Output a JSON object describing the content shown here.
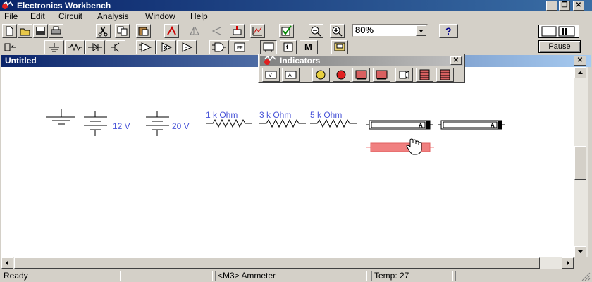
{
  "app": {
    "title": "Electronics Workbench"
  },
  "window_controls": {
    "minimize": "_",
    "restore": "❐",
    "close": "✕"
  },
  "menu": {
    "items": [
      {
        "label": "File"
      },
      {
        "label": "Edit"
      },
      {
        "label": "Circuit"
      },
      {
        "label": "Analysis"
      },
      {
        "label": "Window"
      },
      {
        "label": "Help"
      }
    ]
  },
  "toolbar": {
    "zoom_value": "80%",
    "help_label": "?",
    "pause_label": "Pause",
    "flip_label": "M"
  },
  "document": {
    "title": "Untitled",
    "close": "✕"
  },
  "palette": {
    "title": "Indicators",
    "close": "✕"
  },
  "circuit": {
    "battery1_label": "12 V",
    "battery2_label": "20 V",
    "resistor1_label": "1 k Ohm",
    "resistor2_label": "3 k Ohm",
    "resistor3_label": "5 k Ohm",
    "ammeter_symbol": "A"
  },
  "status": {
    "state": "Ready",
    "component": "<M3> Ammeter",
    "temp": "Temp: 27"
  },
  "colors": {
    "title_bar": "#0a246a",
    "label_blue": "#4a55d8",
    "selected_ammeter": "#f08080"
  }
}
